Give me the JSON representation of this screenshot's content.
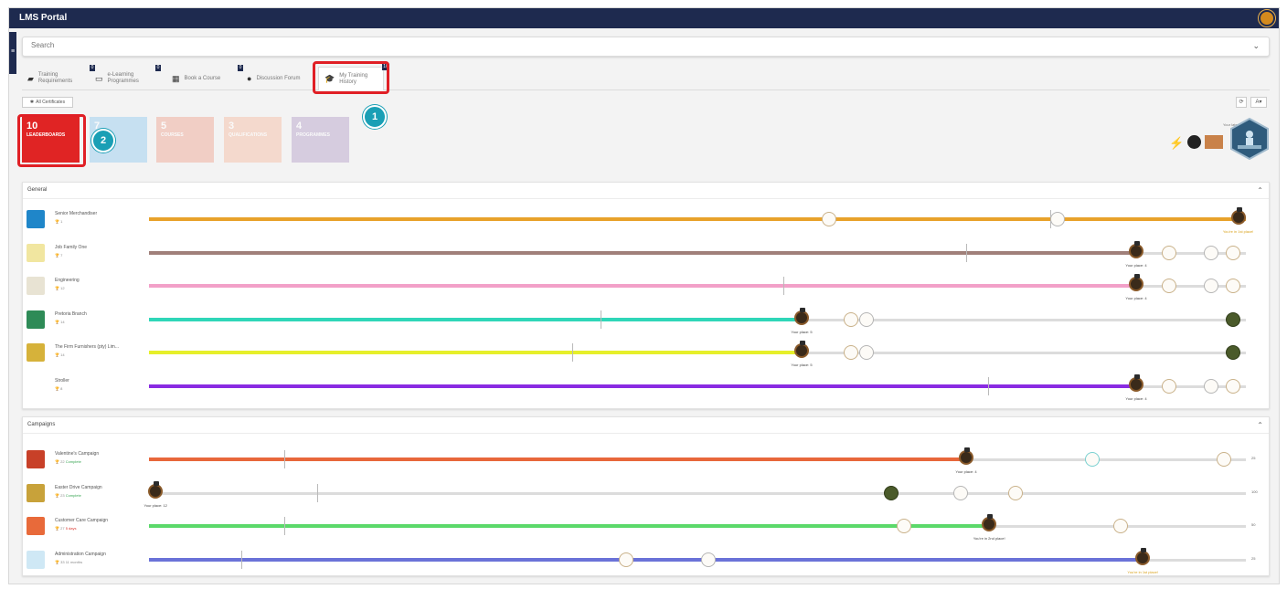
{
  "app": {
    "title": "LMS Portal"
  },
  "search": {
    "placeholder": "Search"
  },
  "tabs": [
    {
      "label": "Training Requirements",
      "badge": "0",
      "icon": "book-icon"
    },
    {
      "label": "e-Learning Programmes",
      "badge": "0",
      "icon": "laptop-icon"
    },
    {
      "label": "Book a Course",
      "badge": "0",
      "icon": "calendar-icon"
    },
    {
      "label": "Discussion Forum",
      "badge": "",
      "icon": "question-circle-icon"
    },
    {
      "label": "My Training History",
      "badge": "10",
      "icon": "graduation-cap-icon",
      "active": true
    }
  ],
  "toolbar": {
    "certificates_label": "All Certificates",
    "refresh_label": "⟳",
    "sort_label": "A▾"
  },
  "annotations": {
    "step1": "1",
    "step2": "2",
    "highlight_color": "#e01f25",
    "step_color": "#1a9fb5"
  },
  "tiles": [
    {
      "count": "10",
      "label": "LEADERBOARDS",
      "color": "#e02424",
      "opacity": 1
    },
    {
      "count": "7",
      "label": "",
      "color": "#a9d4f0",
      "opacity": 0.6
    },
    {
      "count": "5",
      "label": "COURSES",
      "color": "#f0b7a8",
      "opacity": 0.6
    },
    {
      "count": "3",
      "label": "QUALIFICATIONS",
      "color": "#f6c9b4",
      "opacity": 0.6
    },
    {
      "count": "4",
      "label": "PROGRAMMES",
      "color": "#c3b3d3",
      "opacity": 0.6
    }
  ],
  "latest_badges": {
    "label": "Your latest badges"
  },
  "general": {
    "title": "General",
    "rows": [
      {
        "name": "Senior Merchandiser",
        "count": "1",
        "color": "#e8a22a",
        "fill": 1.0,
        "ticks": [
          0.822
        ],
        "markers": [
          {
            "pos": 0.62,
            "kind": "trophy"
          },
          {
            "pos": 0.828,
            "kind": "silver"
          },
          {
            "pos": 0.993,
            "kind": "me"
          }
        ],
        "place": "You're in 1st place!",
        "place_pos": 0.993,
        "gold": true,
        "end": ""
      },
      {
        "name": "Job Family One",
        "count": "7",
        "color": "#a0807a",
        "fill": 0.9,
        "ticks": [
          0.745
        ],
        "markers": [
          {
            "pos": 0.9,
            "kind": "me"
          },
          {
            "pos": 0.93,
            "kind": "trophy"
          },
          {
            "pos": 0.968,
            "kind": "silver"
          },
          {
            "pos": 0.988,
            "kind": "trophy"
          }
        ],
        "place": "Your place: 4",
        "place_pos": 0.9,
        "gold": false,
        "end": ""
      },
      {
        "name": "Engineering",
        "count": "12",
        "color": "#f2a0c8",
        "fill": 0.9,
        "ticks": [
          0.578
        ],
        "markers": [
          {
            "pos": 0.9,
            "kind": "me"
          },
          {
            "pos": 0.93,
            "kind": "trophy"
          },
          {
            "pos": 0.968,
            "kind": "silver"
          },
          {
            "pos": 0.988,
            "kind": "trophy"
          }
        ],
        "place": "Your place: 4",
        "place_pos": 0.9,
        "gold": false,
        "end": ""
      },
      {
        "name": "Pretoria Branch",
        "count": "14",
        "color": "#2fd6b8",
        "fill": 0.595,
        "ticks": [
          0.412
        ],
        "markers": [
          {
            "pos": 0.595,
            "kind": "me"
          },
          {
            "pos": 0.64,
            "kind": "trophy"
          },
          {
            "pos": 0.654,
            "kind": "silver"
          },
          {
            "pos": 0.988,
            "kind": "dark"
          }
        ],
        "place": "Your place: 5",
        "place_pos": 0.595,
        "gold": false,
        "end": ""
      },
      {
        "name": "The Firm Furnishers (pty) Lim...",
        "count": "14",
        "color": "#e6ef2a",
        "fill": 0.595,
        "ticks": [
          0.386
        ],
        "markers": [
          {
            "pos": 0.595,
            "kind": "me"
          },
          {
            "pos": 0.64,
            "kind": "trophy"
          },
          {
            "pos": 0.654,
            "kind": "silver"
          },
          {
            "pos": 0.988,
            "kind": "dark"
          }
        ],
        "place": "Your place: 5",
        "place_pos": 0.595,
        "gold": false,
        "end": ""
      },
      {
        "name": "Stroller",
        "count": "8",
        "color": "#8a2be2",
        "fill": 0.9,
        "ticks": [
          0.765
        ],
        "markers": [
          {
            "pos": 0.9,
            "kind": "me"
          },
          {
            "pos": 0.93,
            "kind": "trophy"
          },
          {
            "pos": 0.968,
            "kind": "silver"
          },
          {
            "pos": 0.988,
            "kind": "trophy"
          }
        ],
        "place": "Your place: 4",
        "place_pos": 0.9,
        "gold": false,
        "end": ""
      }
    ]
  },
  "campaigns": {
    "title": "Campaigns",
    "rows": [
      {
        "name": "Valentine's Campaign",
        "count": "22",
        "status": "Complete",
        "status_kind": "ok",
        "color": "#e8673b",
        "fill": 0.745,
        "ticks": [
          0.123
        ],
        "markers": [
          {
            "pos": 0.745,
            "kind": "me"
          },
          {
            "pos": 0.86,
            "kind": "cyan"
          },
          {
            "pos": 0.98,
            "kind": "trophy"
          }
        ],
        "place": "Your place: 4",
        "place_pos": 0.745,
        "gold": false,
        "end": "25"
      },
      {
        "name": "Easter Drive Campaign",
        "count": "23",
        "status": "Complete",
        "status_kind": "ok",
        "color": "#dcdcdc",
        "fill": 0.0,
        "ticks": [
          0.153
        ],
        "markers": [
          {
            "pos": 0.006,
            "kind": "me"
          },
          {
            "pos": 0.677,
            "kind": "dark"
          },
          {
            "pos": 0.74,
            "kind": "silver"
          },
          {
            "pos": 0.79,
            "kind": "trophy"
          }
        ],
        "place": "Your place: 12",
        "place_pos": 0.006,
        "gold": false,
        "end": "100"
      },
      {
        "name": "Customer Care Campaign",
        "count": "27",
        "status": "5 days",
        "status_kind": "bad",
        "color": "#5bd96a",
        "fill": 0.764,
        "ticks": [
          0.123
        ],
        "markers": [
          {
            "pos": 0.688,
            "kind": "trophy"
          },
          {
            "pos": 0.766,
            "kind": "me"
          },
          {
            "pos": 0.886,
            "kind": "trophy"
          }
        ],
        "place": "You're in 2nd place!",
        "place_pos": 0.766,
        "gold": false,
        "end": "50"
      },
      {
        "name": "Administration Campaign",
        "count": "33",
        "status": "11 months",
        "status_kind": "neutral",
        "color": "#6a72d8",
        "fill": 0.906,
        "ticks": [
          0.084
        ],
        "markers": [
          {
            "pos": 0.435,
            "kind": "trophy"
          },
          {
            "pos": 0.51,
            "kind": "silver"
          },
          {
            "pos": 0.906,
            "kind": "me"
          }
        ],
        "place": "You're in 1st place!",
        "place_pos": 0.906,
        "gold": true,
        "end": "25"
      }
    ]
  }
}
